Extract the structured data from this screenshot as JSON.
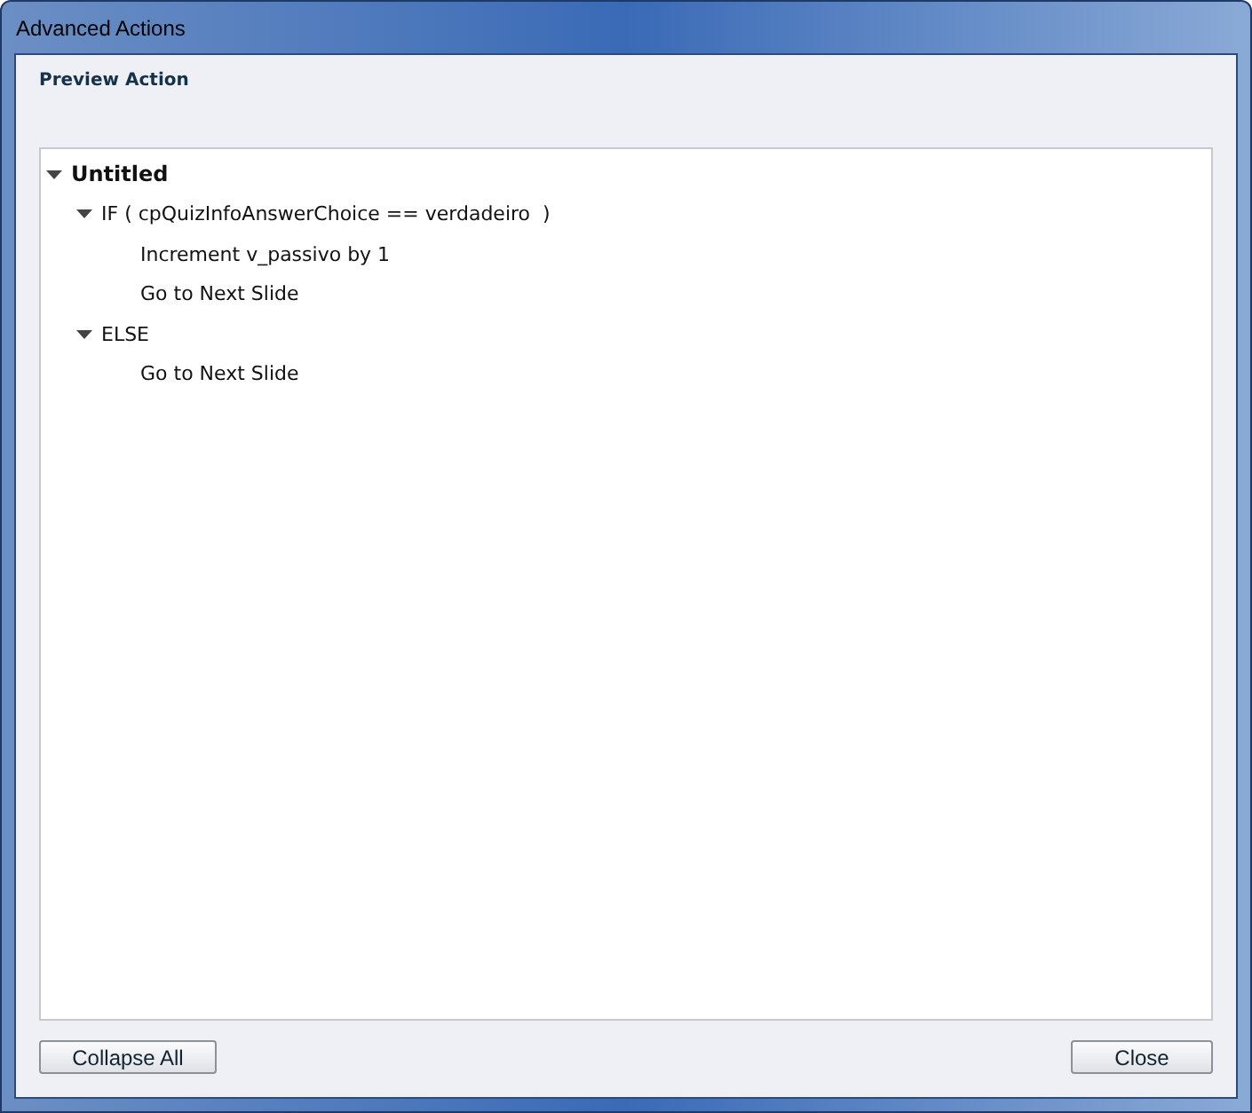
{
  "window": {
    "title": "Advanced Actions"
  },
  "section_title": "Preview Action",
  "tree": [
    {
      "label": "Untitled",
      "expanded": true,
      "children": [
        {
          "label": "IF ( cpQuizInfoAnswerChoice == verdadeiro  )",
          "expanded": true,
          "children": [
            {
              "label": "Increment v_passivo by 1"
            },
            {
              "label": "Go to Next Slide"
            }
          ]
        },
        {
          "label": "ELSE",
          "expanded": true,
          "children": [
            {
              "label": "Go to Next Slide"
            }
          ]
        }
      ]
    }
  ],
  "buttons": {
    "left": "Collapse All",
    "right": "Close"
  }
}
